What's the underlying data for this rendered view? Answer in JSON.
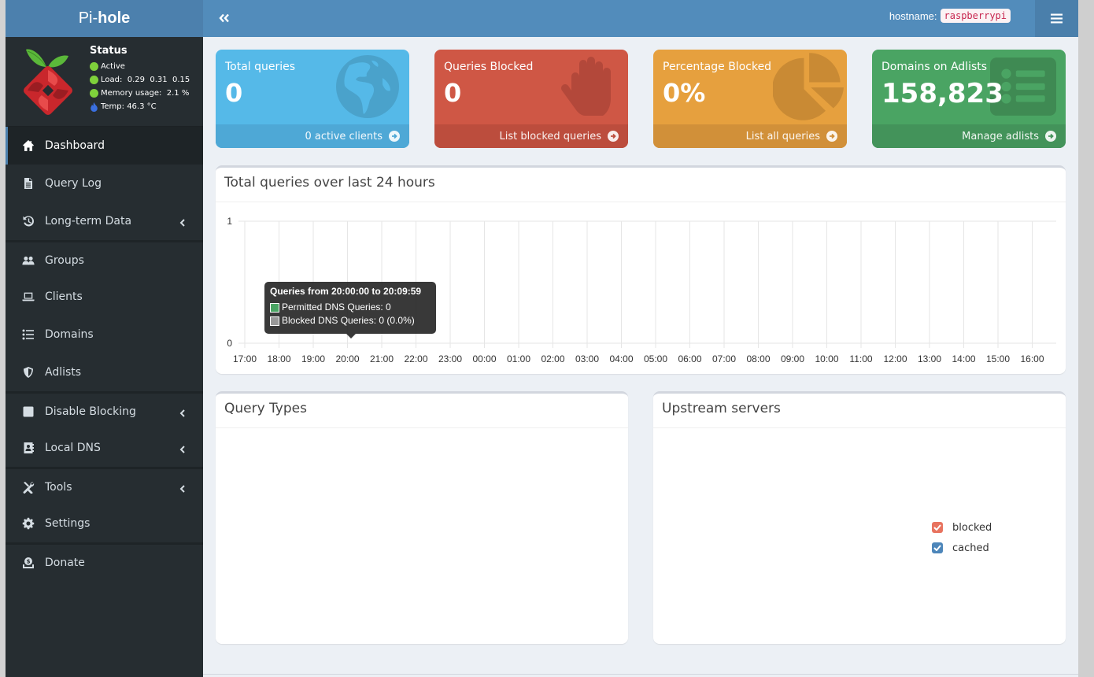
{
  "brand": {
    "prefix": "Pi-",
    "name": "hole"
  },
  "status": {
    "title": "Status",
    "active": "Active",
    "load": "Load:  0.29  0.31  0.15",
    "memory": "Memory usage:  2.1 %",
    "temp": "Temp: 46.3 °C",
    "colors": {
      "ok": "#7fd13b",
      "temp": "#3a6fe0"
    }
  },
  "sidebar": {
    "items": [
      {
        "label": "Dashboard",
        "icon": "home-icon",
        "active": true
      },
      {
        "label": "Query Log",
        "icon": "file-icon"
      },
      {
        "label": "Long-term Data",
        "icon": "history-icon",
        "submenu": true
      },
      {
        "label": "Groups",
        "icon": "users-icon"
      },
      {
        "label": "Clients",
        "icon": "laptop-icon"
      },
      {
        "label": "Domains",
        "icon": "list-icon"
      },
      {
        "label": "Adlists",
        "icon": "shield-icon"
      },
      {
        "label": "Disable Blocking",
        "icon": "stop-icon",
        "submenu": true
      },
      {
        "label": "Local DNS",
        "icon": "address-book-icon",
        "submenu": true
      },
      {
        "label": "Tools",
        "icon": "tools-icon",
        "submenu": true
      },
      {
        "label": "Settings",
        "icon": "gear-icon"
      },
      {
        "label": "Donate",
        "icon": "donate-icon"
      }
    ]
  },
  "header": {
    "hostname_label": "hostname:",
    "hostname_value": "raspberrypi"
  },
  "boxes": [
    {
      "title": "Total queries",
      "value": "0",
      "footer": "0 active clients",
      "icon": "globe-icon",
      "color": "#55b9e8"
    },
    {
      "title": "Queries Blocked",
      "value": "0",
      "footer": "List blocked queries",
      "icon": "hand-icon",
      "color": "#cf5745"
    },
    {
      "title": "Percentage Blocked",
      "value": "0%",
      "footer": "List all queries",
      "icon": "pie-chart-icon",
      "color": "#e6a03e"
    },
    {
      "title": "Domains on Adlists",
      "value": "158,823",
      "footer": "Manage adlists",
      "icon": "list-alt-icon",
      "color": "#4aa463"
    }
  ],
  "panels": {
    "queries_over_time": "Total queries over last 24 hours",
    "query_types": "Query Types",
    "upstream_servers": "Upstream servers"
  },
  "tooltip": {
    "title": "Queries from 20:00:00 to 20:09:59",
    "permitted": "Permitted DNS Queries: 0",
    "blocked": "Blocked DNS Queries: 0 (0.0%)",
    "permitted_color": "#4aa463",
    "blocked_color": "#999999"
  },
  "upstream_legend": [
    {
      "label": "blocked",
      "color": "#e8735f",
      "checked": true
    },
    {
      "label": "cached",
      "color": "#4d86ba",
      "checked": true
    }
  ],
  "chart_data": {
    "type": "bar",
    "title": "Total queries over last 24 hours",
    "xlabel": "",
    "ylabel": "",
    "categories": [
      "17:00",
      "18:00",
      "19:00",
      "20:00",
      "21:00",
      "22:00",
      "23:00",
      "00:00",
      "01:00",
      "02:00",
      "03:00",
      "04:00",
      "05:00",
      "06:00",
      "07:00",
      "08:00",
      "09:00",
      "10:00",
      "11:00",
      "12:00",
      "13:00",
      "14:00",
      "15:00",
      "16:00"
    ],
    "series": [
      {
        "name": "Permitted DNS Queries",
        "values": [
          0,
          0,
          0,
          0,
          0,
          0,
          0,
          0,
          0,
          0,
          0,
          0,
          0,
          0,
          0,
          0,
          0,
          0,
          0,
          0,
          0,
          0,
          0,
          0
        ],
        "color": "#4aa463"
      },
      {
        "name": "Blocked DNS Queries",
        "values": [
          0,
          0,
          0,
          0,
          0,
          0,
          0,
          0,
          0,
          0,
          0,
          0,
          0,
          0,
          0,
          0,
          0,
          0,
          0,
          0,
          0,
          0,
          0,
          0
        ],
        "color": "#999999"
      }
    ],
    "yticks": [
      "0",
      "1"
    ],
    "ylim": [
      0,
      1
    ],
    "grid": true
  }
}
